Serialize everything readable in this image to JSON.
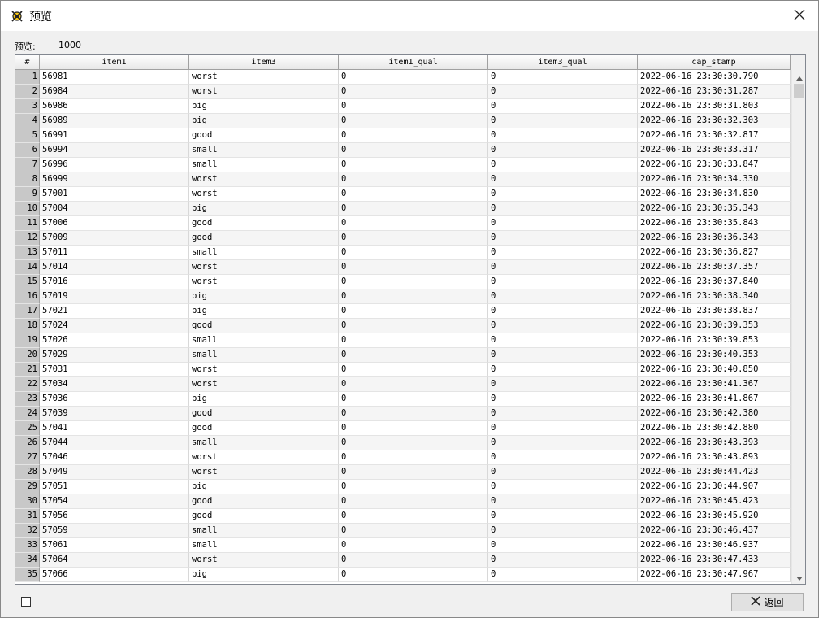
{
  "window": {
    "title": "预览",
    "icon": "app-icon",
    "close_icon": "close-icon"
  },
  "preview": {
    "label": "预览:",
    "count": "1000"
  },
  "table": {
    "headers": [
      "#",
      "item1",
      "item3",
      "item1_qual",
      "item3_qual",
      "cap_stamp"
    ],
    "rows": [
      [
        "1",
        "56981",
        "worst",
        "0",
        "0",
        "2022-06-16 23:30:30.790"
      ],
      [
        "2",
        "56984",
        "worst",
        "0",
        "0",
        "2022-06-16 23:30:31.287"
      ],
      [
        "3",
        "56986",
        "big",
        "0",
        "0",
        "2022-06-16 23:30:31.803"
      ],
      [
        "4",
        "56989",
        "big",
        "0",
        "0",
        "2022-06-16 23:30:32.303"
      ],
      [
        "5",
        "56991",
        "good",
        "0",
        "0",
        "2022-06-16 23:30:32.817"
      ],
      [
        "6",
        "56994",
        "small",
        "0",
        "0",
        "2022-06-16 23:30:33.317"
      ],
      [
        "7",
        "56996",
        "small",
        "0",
        "0",
        "2022-06-16 23:30:33.847"
      ],
      [
        "8",
        "56999",
        "worst",
        "0",
        "0",
        "2022-06-16 23:30:34.330"
      ],
      [
        "9",
        "57001",
        "worst",
        "0",
        "0",
        "2022-06-16 23:30:34.830"
      ],
      [
        "10",
        "57004",
        "big",
        "0",
        "0",
        "2022-06-16 23:30:35.343"
      ],
      [
        "11",
        "57006",
        "good",
        "0",
        "0",
        "2022-06-16 23:30:35.843"
      ],
      [
        "12",
        "57009",
        "good",
        "0",
        "0",
        "2022-06-16 23:30:36.343"
      ],
      [
        "13",
        "57011",
        "small",
        "0",
        "0",
        "2022-06-16 23:30:36.827"
      ],
      [
        "14",
        "57014",
        "worst",
        "0",
        "0",
        "2022-06-16 23:30:37.357"
      ],
      [
        "15",
        "57016",
        "worst",
        "0",
        "0",
        "2022-06-16 23:30:37.840"
      ],
      [
        "16",
        "57019",
        "big",
        "0",
        "0",
        "2022-06-16 23:30:38.340"
      ],
      [
        "17",
        "57021",
        "big",
        "0",
        "0",
        "2022-06-16 23:30:38.837"
      ],
      [
        "18",
        "57024",
        "good",
        "0",
        "0",
        "2022-06-16 23:30:39.353"
      ],
      [
        "19",
        "57026",
        "small",
        "0",
        "0",
        "2022-06-16 23:30:39.853"
      ],
      [
        "20",
        "57029",
        "small",
        "0",
        "0",
        "2022-06-16 23:30:40.353"
      ],
      [
        "21",
        "57031",
        "worst",
        "0",
        "0",
        "2022-06-16 23:30:40.850"
      ],
      [
        "22",
        "57034",
        "worst",
        "0",
        "0",
        "2022-06-16 23:30:41.367"
      ],
      [
        "23",
        "57036",
        "big",
        "0",
        "0",
        "2022-06-16 23:30:41.867"
      ],
      [
        "24",
        "57039",
        "good",
        "0",
        "0",
        "2022-06-16 23:30:42.380"
      ],
      [
        "25",
        "57041",
        "good",
        "0",
        "0",
        "2022-06-16 23:30:42.880"
      ],
      [
        "26",
        "57044",
        "small",
        "0",
        "0",
        "2022-06-16 23:30:43.393"
      ],
      [
        "27",
        "57046",
        "worst",
        "0",
        "0",
        "2022-06-16 23:30:43.893"
      ],
      [
        "28",
        "57049",
        "worst",
        "0",
        "0",
        "2022-06-16 23:30:44.423"
      ],
      [
        "29",
        "57051",
        "big",
        "0",
        "0",
        "2022-06-16 23:30:44.907"
      ],
      [
        "30",
        "57054",
        "good",
        "0",
        "0",
        "2022-06-16 23:30:45.423"
      ],
      [
        "31",
        "57056",
        "good",
        "0",
        "0",
        "2022-06-16 23:30:45.920"
      ],
      [
        "32",
        "57059",
        "small",
        "0",
        "0",
        "2022-06-16 23:30:46.437"
      ],
      [
        "33",
        "57061",
        "small",
        "0",
        "0",
        "2022-06-16 23:30:46.937"
      ],
      [
        "34",
        "57064",
        "worst",
        "0",
        "0",
        "2022-06-16 23:30:47.433"
      ],
      [
        "35",
        "57066",
        "big",
        "0",
        "0",
        "2022-06-16 23:30:47.967"
      ]
    ]
  },
  "footer": {
    "checkbox_icon": "checkbox-icon",
    "return_label": "返回",
    "return_icon": "x-icon"
  }
}
